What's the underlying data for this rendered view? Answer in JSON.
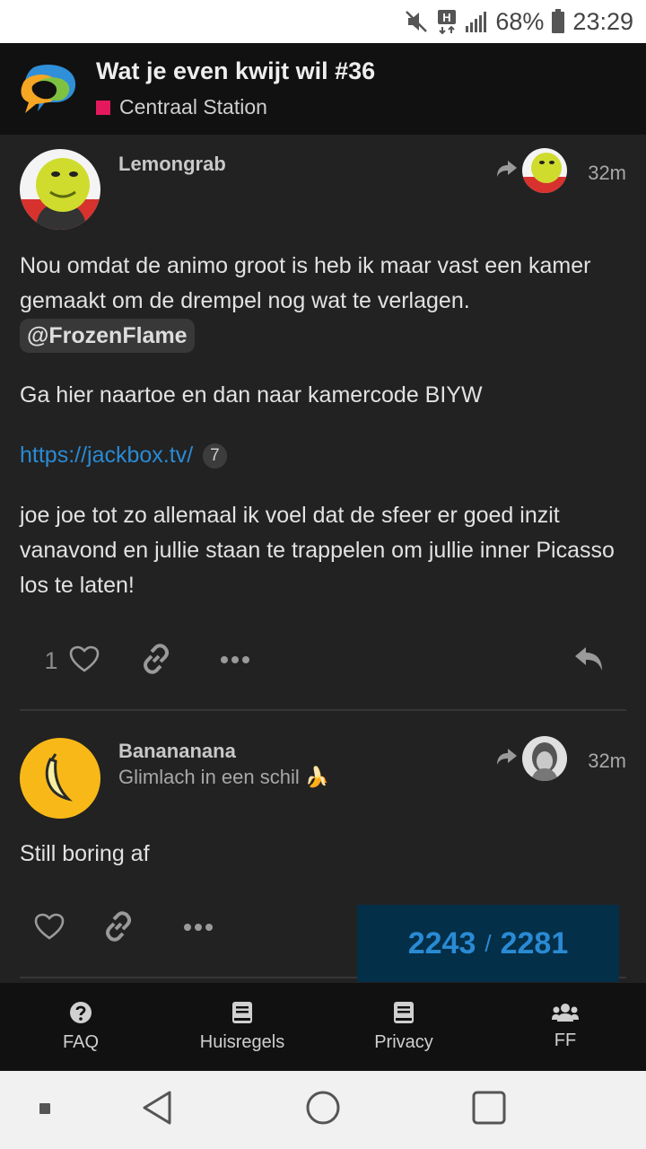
{
  "status_bar": {
    "battery": "68%",
    "time": "23:29"
  },
  "header": {
    "topic_title": "Wat je even kwijt wil #36",
    "category": "Centraal Station",
    "category_color": "#e4185d"
  },
  "posts": [
    {
      "username": "Lemongrab",
      "time": "32m",
      "paragraph1": "Nou omdat de animo groot is heb ik maar vast een kamer gemaakt om de drempel nog wat te verlagen.",
      "mention": "@FrozenFlame",
      "paragraph2": "Ga hier naartoe en dan naar kamercode BIYW",
      "link": "https://jackbox.tv/",
      "link_clicks": "7",
      "paragraph3": "joe joe tot zo allemaal ik voel dat de sfeer er goed inzit vanavond en jullie staan te trappelen om jullie inner Picasso los te laten!",
      "like_count": "1"
    },
    {
      "username": "Banananana",
      "user_title": "Glimlach in een schil 🍌",
      "time": "32m",
      "text": "Still boring af"
    }
  ],
  "progress": {
    "current": "2243",
    "separator": "/",
    "total": "2281"
  },
  "footer": {
    "items": [
      {
        "label": "FAQ",
        "icon": "question-circle-icon"
      },
      {
        "label": "Huisregels",
        "icon": "book-icon"
      },
      {
        "label": "Privacy",
        "icon": "book-icon"
      },
      {
        "label": "FF",
        "icon": "users-icon"
      }
    ]
  },
  "colors": {
    "accent": "#2a8ad4",
    "background": "#222222",
    "header": "#111111",
    "progress_bg": "#032f48"
  }
}
